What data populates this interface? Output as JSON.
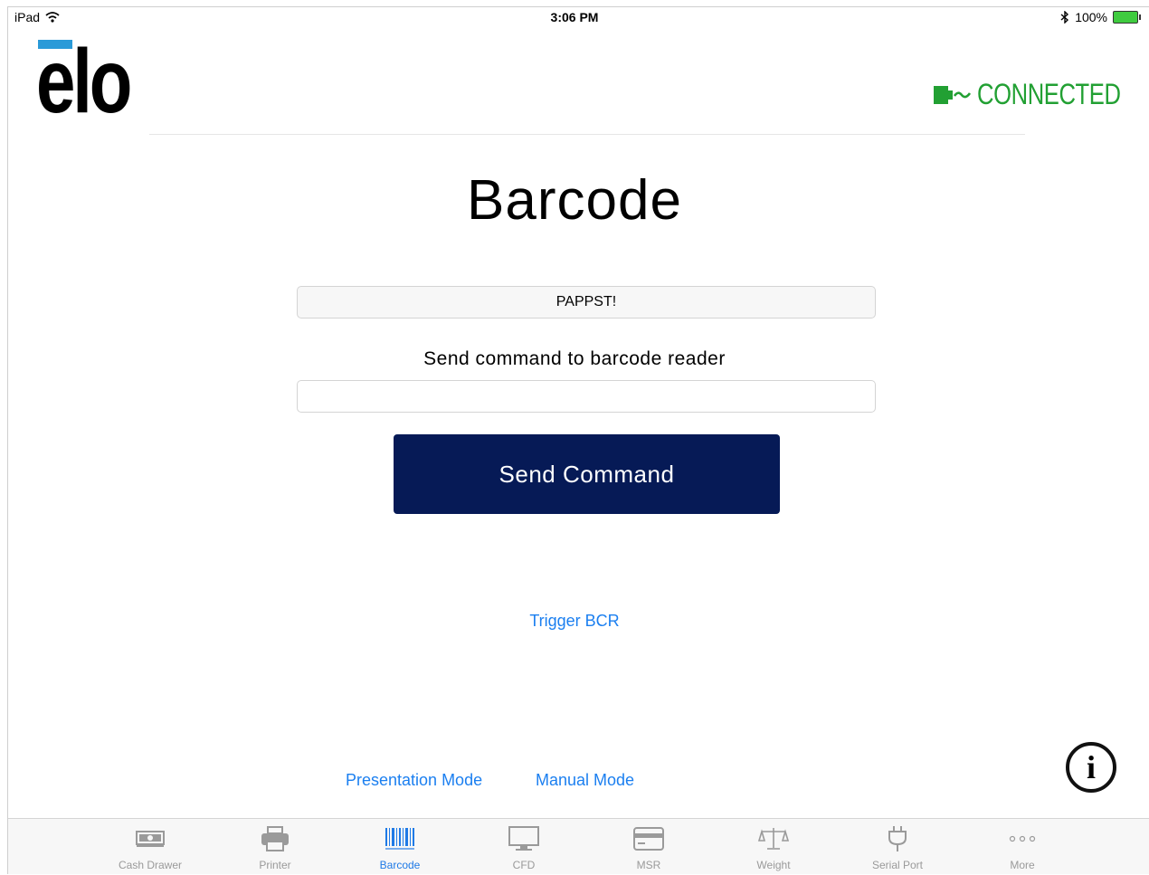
{
  "status_bar": {
    "device": "iPad",
    "time": "3:06 PM",
    "battery": "100%"
  },
  "header": {
    "logo": "elo",
    "connection_status": "CONNECTED",
    "connection_color": "#22a033"
  },
  "page": {
    "title": "Barcode",
    "scanned_value": "PAPPST!",
    "command_label": "Send command to barcode reader",
    "command_value": "",
    "send_button": "Send Command",
    "trigger_link": "Trigger BCR",
    "presentation_mode_link": "Presentation Mode",
    "manual_mode_link": "Manual Mode",
    "button_color": "#061a56",
    "link_color": "#1b7ff0"
  },
  "tab_bar": {
    "active_color": "#1f7ae6",
    "items": [
      {
        "label": "Cash Drawer",
        "icon": "cash-drawer-icon",
        "active": false
      },
      {
        "label": "Printer",
        "icon": "printer-icon",
        "active": false
      },
      {
        "label": "Barcode",
        "icon": "barcode-icon",
        "active": true
      },
      {
        "label": "CFD",
        "icon": "monitor-icon",
        "active": false
      },
      {
        "label": "MSR",
        "icon": "card-icon",
        "active": false
      },
      {
        "label": "Weight",
        "icon": "scale-icon",
        "active": false
      },
      {
        "label": "Serial Port",
        "icon": "plug-icon",
        "active": false
      },
      {
        "label": "More",
        "icon": "more-icon",
        "active": false
      }
    ]
  }
}
